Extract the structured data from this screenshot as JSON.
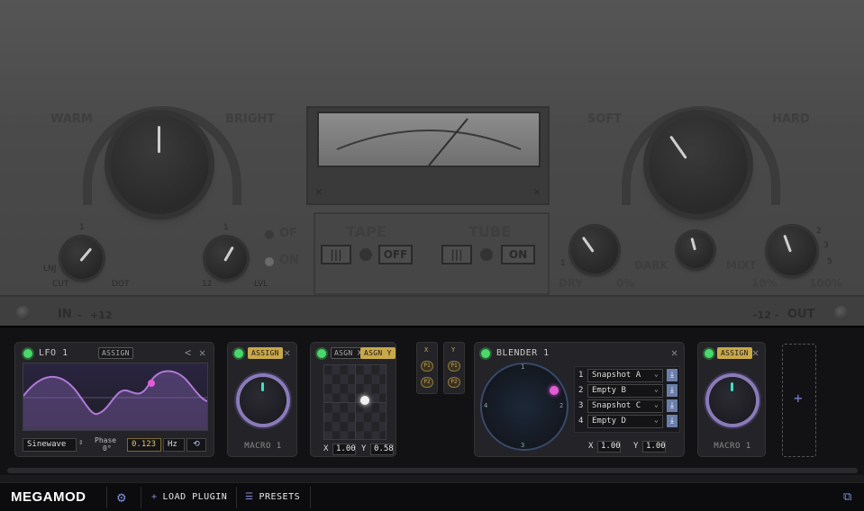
{
  "plugin": {
    "warm": "WARM",
    "bright": "BRIGHT",
    "soft": "SOFT",
    "hard": "HARD",
    "low_cut": "LNJ",
    "cut": "CUT",
    "dot": "DOT",
    "scale_1a": "1",
    "scale_1b": "1",
    "minus12": "12",
    "lvl": "LVL",
    "of": "OF",
    "on": "ON",
    "tape": "TAPE",
    "tape_btn": "OFF",
    "tube": "TUBE",
    "tube_btn": "ON",
    "dark": "DARK",
    "mixt": "MIXT",
    "dry": "DRY",
    "pct0": "0%",
    "pct10": "10%",
    "pct100": "100%",
    "num1": "1",
    "num2": "2",
    "num3": "3",
    "num5": "5",
    "in_label": "IN",
    "in_value": "+12",
    "out_value": "-12",
    "out_label": "OUT"
  },
  "lfo": {
    "title": "LFO 1",
    "assign": "ASSIGN",
    "prev": "<",
    "close": "✕",
    "waveform": "Sinewave",
    "phase_label": "Phase",
    "phase_value": "0°",
    "rate": "0.123",
    "unit": "Hz",
    "loop_icon": "loop-icon"
  },
  "macro_a": {
    "assign": "ASSIGN",
    "close": "✕",
    "label": "MACRO 1"
  },
  "xypad": {
    "assign_x": "ASGN X",
    "assign_y": "ASGN Y",
    "close": "✕",
    "x_label": "X",
    "x_value": "1.00",
    "y_label": "Y",
    "y_value": "0.58"
  },
  "xy_slots": {
    "x": "X",
    "y": "Y",
    "p1": "P1",
    "p2": "P2"
  },
  "blender": {
    "title": "BLENDER 1",
    "close": "✕",
    "dial": [
      "1",
      "2",
      "3",
      "4"
    ],
    "snapshots": [
      {
        "num": "1",
        "name": "Snapshot A"
      },
      {
        "num": "2",
        "name": "Empty B"
      },
      {
        "num": "3",
        "name": "Snapshot C"
      },
      {
        "num": "4",
        "name": "Empty D"
      }
    ],
    "x_label": "X",
    "x_value": "1.00",
    "y_label": "Y",
    "y_value": "1.00"
  },
  "macro_b": {
    "assign": "ASSIGN",
    "close": "✕",
    "label": "MACRO 1"
  },
  "add_slot": "+",
  "bottom": {
    "logo": "MEGAMOD",
    "load_plugin": "LOAD PLUGIN",
    "presets": "PRESETS"
  },
  "colors": {
    "accent": "#c9a84a",
    "led": "#49d96b",
    "wave": "#b07ad8",
    "knob_ring": "#8a7bb8",
    "knob_tick": "#3fe0c5"
  }
}
